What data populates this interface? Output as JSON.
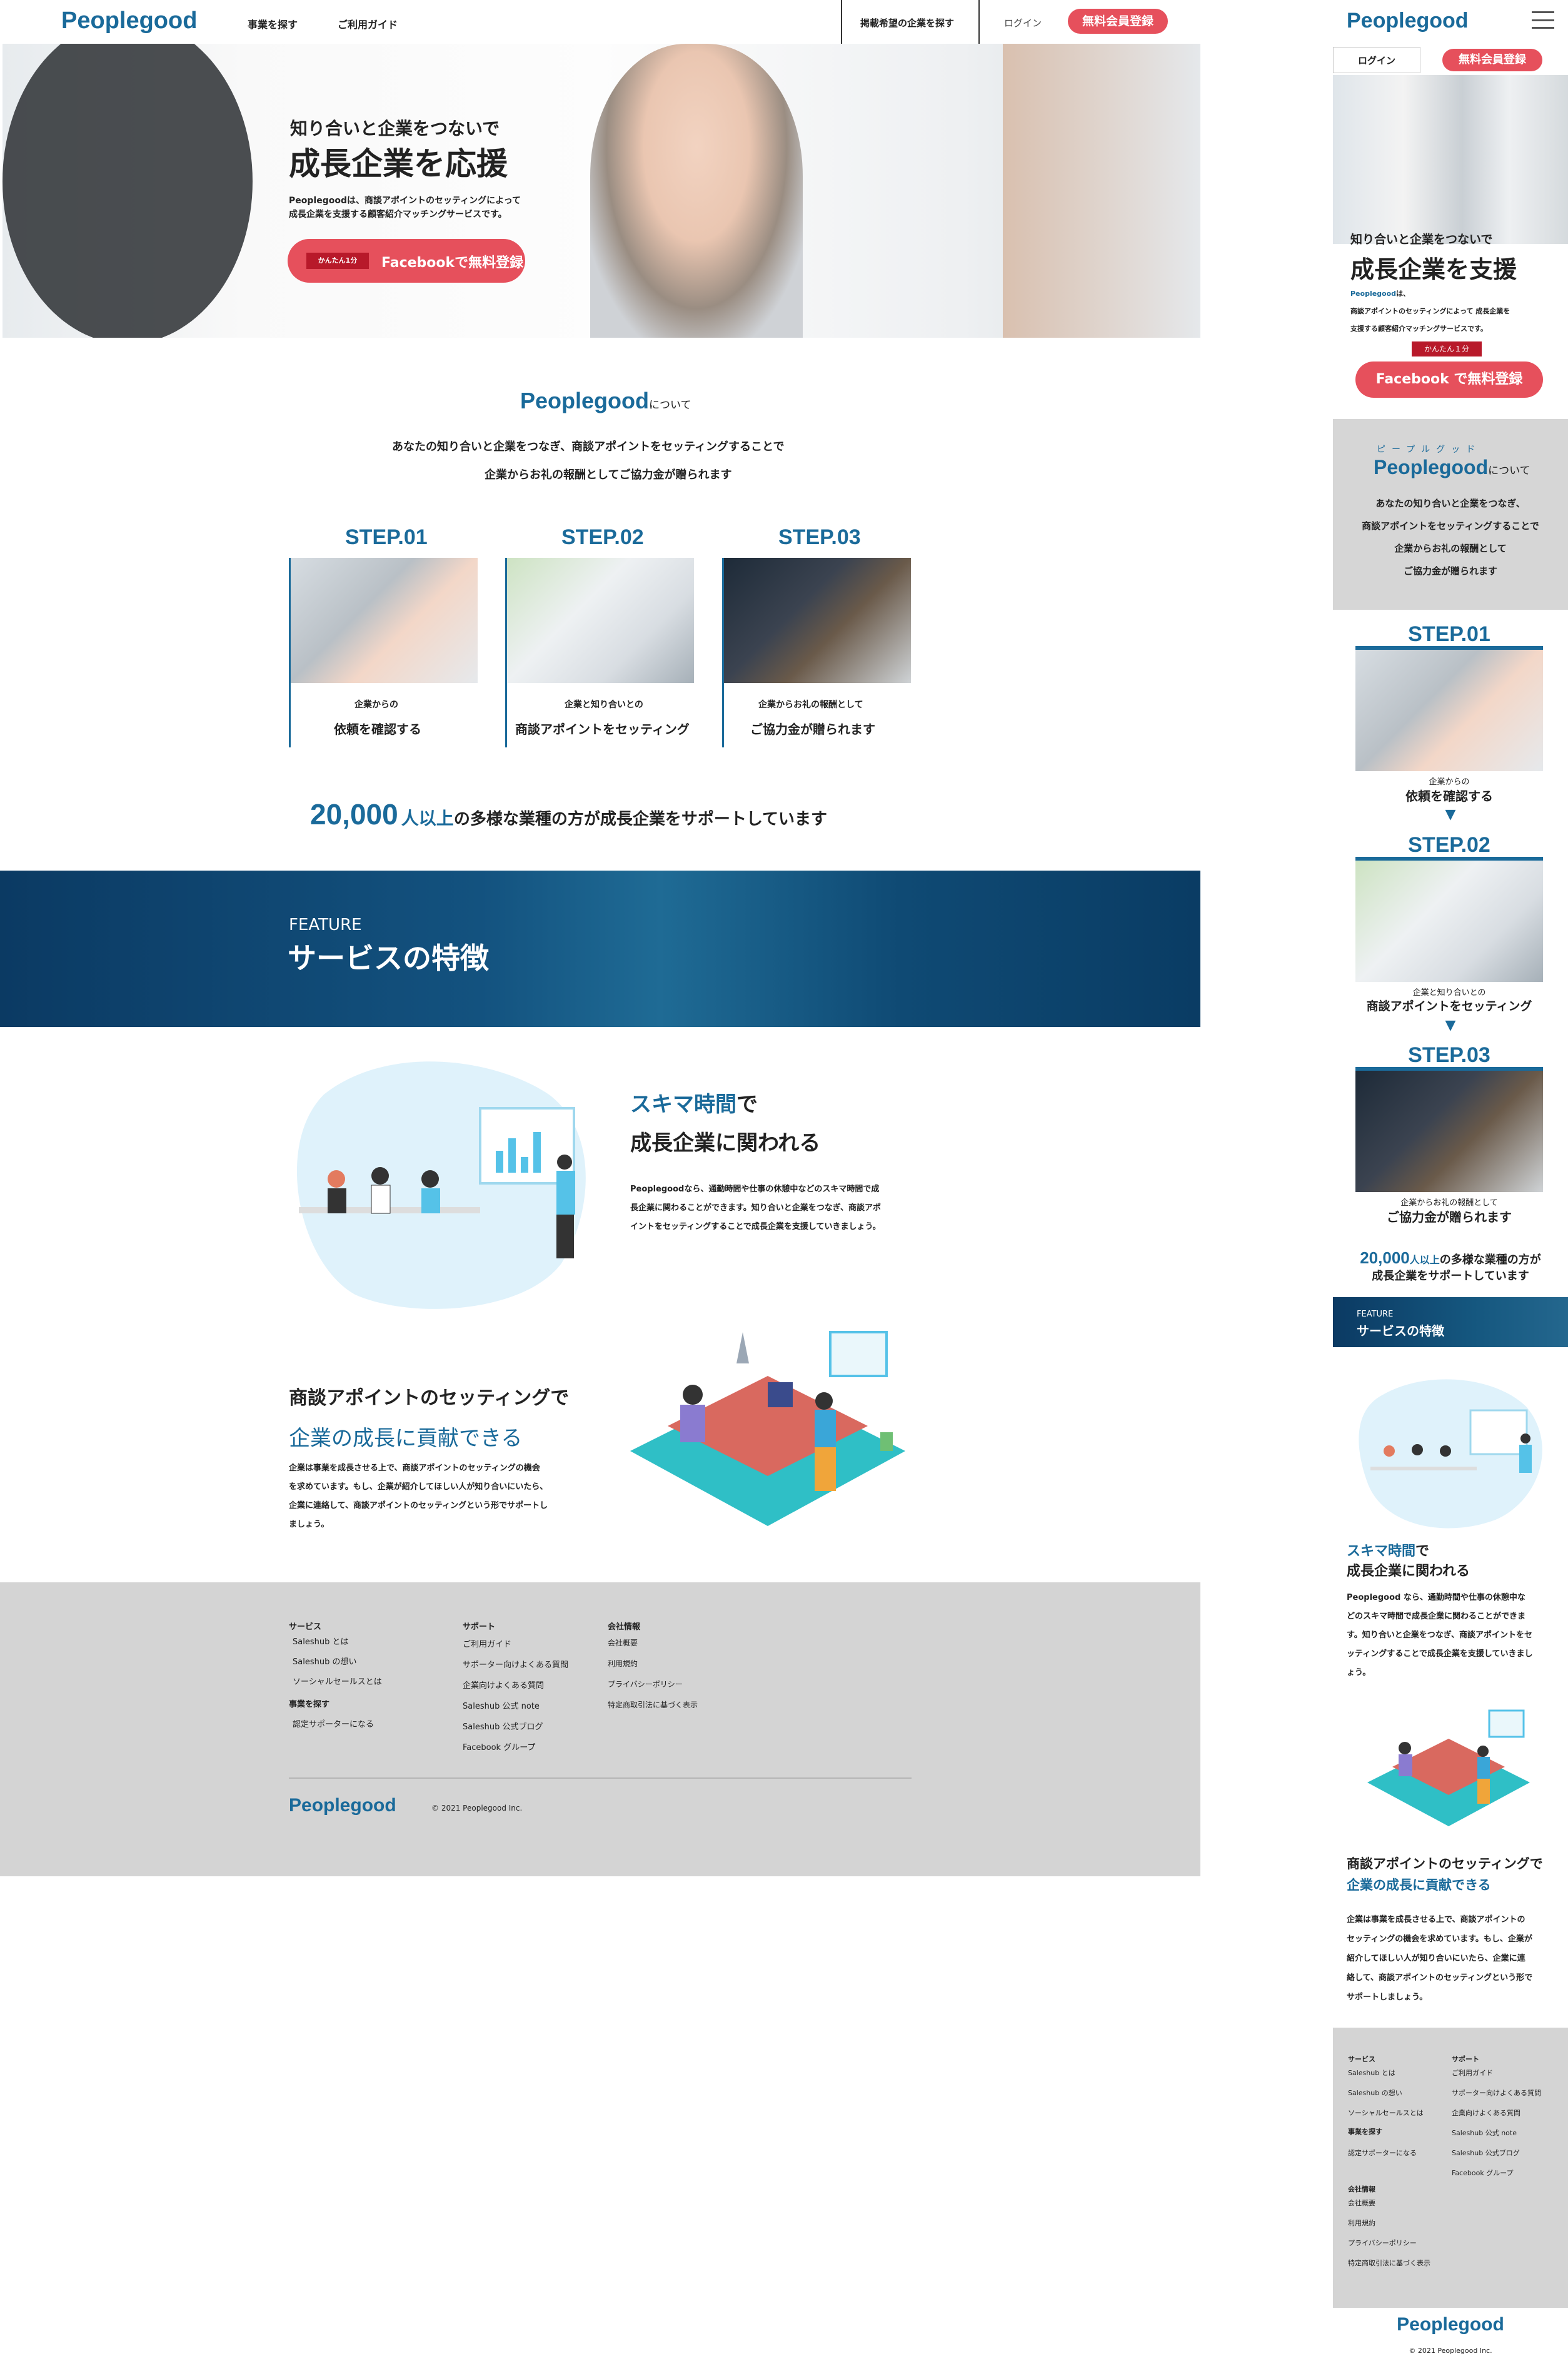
{
  "desktop": {
    "header": {
      "logo": "Peoplegood",
      "nav": [
        "事業を探す",
        "ご利用ガイド"
      ],
      "listing": "掲載希望の企業を探す",
      "login": "ログイン",
      "signup": "無料会員登録"
    },
    "hero": {
      "sub": "知り合いと企業をつないで",
      "title": "成長企業を応援",
      "desc1": "Peoplegoodは、商談アポイントのセッティングによって",
      "desc2": "成長企業を支援する顧客紹介マッチングサービスです。",
      "badge": "かんたん1分",
      "cta": "Facebookで無料登録"
    },
    "about": {
      "logo": "Peoplegood",
      "suffix": "について",
      "line1": "あなたの知り合いと企業をつなぎ、商談アポイントをセッティングすることで",
      "line2": "企業からお礼の報酬としてご協力金が贈られます"
    },
    "steps": [
      {
        "label": "STEP.01",
        "small": "企業からの",
        "big": "依頼を確認する"
      },
      {
        "label": "STEP.02",
        "small": "企業と知り合いとの",
        "big": "商談アポイントをセッティング"
      },
      {
        "label": "STEP.03",
        "small": "企業からお礼の報酬として",
        "big": "ご協力金が贈られます"
      }
    ],
    "stat": {
      "num": "20,000",
      "unit": "人以上",
      "text": "の多様な業種の方が成長企業をサポートしています"
    },
    "feature": {
      "en": "FEATURE",
      "jp": "サービスの特徴"
    },
    "f1": {
      "accent": "スキマ時間",
      "rest": "で",
      "line2": "成長企業に関われる",
      "desc1": "Peoplegoodなら、通勤時間や仕事の休憩中などのスキマ時間で成",
      "desc2": "長企業に関わることができます。知り合いと企業をつなぎ、商談アポ",
      "desc3": "イントをセッティングすることで成長企業を支援していきましょう。"
    },
    "f2": {
      "line1": "商談アポイントのセッティングで",
      "accent": "企業の成長に貢献できる",
      "desc1": "企業は事業を成長させる上で、商談アポイントのセッティングの機会",
      "desc2": "を求めています。もし、企業が紹介してほしい人が知り合いにいたら、",
      "desc3": "企業に連絡して、商談アポイントのセッティングという形でサポートし",
      "desc4": "ましょう。"
    },
    "footer": {
      "col1": {
        "h1": "サービス",
        "items": [
          "Saleshub とは",
          "Saleshub の想い",
          "ソーシャルセールスとは"
        ],
        "h2": "事業を探す",
        "items2": [
          "認定サポーターになる"
        ]
      },
      "col2": {
        "h": "サポート",
        "items": [
          "ご利用ガイド",
          "サポーター向けよくある質問",
          "企業向けよくある質問",
          "Saleshub 公式 note",
          "Saleshub 公式ブログ",
          "Facebook グループ"
        ]
      },
      "col3": {
        "h": "会社情報",
        "items": [
          "会社概要",
          "利用規約",
          "プライバシーポリシー",
          "特定商取引法に基づく表示"
        ]
      },
      "logo": "Peoplegood",
      "copy": "© 2021 Peoplegood Inc."
    }
  },
  "mobile": {
    "logo": "Peoplegood",
    "login": "ログイン",
    "signup": "無料会員登録",
    "hero": {
      "sub": "知り合いと企業をつないで",
      "title": "成長企業を支援",
      "brand": "Peoplegood",
      "desc0": "は、",
      "desc1": "商談アポイントのセッティングによって 成長企業を",
      "desc2": "支援する顧客紹介マッチングサービスです。",
      "badge": "かんたん１分",
      "cta": "Facebook で無料登録"
    },
    "about": {
      "ruby": "ピープルグッド",
      "logo": "Peoplegood",
      "suffix": "について",
      "lines": [
        "あなたの知り合いと企業をつなぎ、",
        "商談アポイントをセッティングすることで",
        "企業からお礼の報酬として",
        "ご協力金が贈られます"
      ]
    },
    "steps": [
      {
        "label": "STEP.01",
        "small": "企業からの",
        "big": "依頼を確認する"
      },
      {
        "label": "STEP.02",
        "small": "企業と知り合いとの",
        "big": "商談アポイントをセッティング"
      },
      {
        "label": "STEP.03",
        "small": "企業からお礼の報酬として",
        "big": "ご協力金が贈られます"
      }
    ],
    "arrow": "▼",
    "stat": {
      "num": "20,000",
      "unit": "人以上",
      "t1": "の多様な業種の方が",
      "t2": "成長企業をサポートしています"
    },
    "feature": {
      "en": "FEATURE",
      "jp": "サービスの特徴"
    },
    "f1": {
      "accent": "スキマ時間",
      "rest": "で",
      "line2": "成長企業に関われる",
      "lines": [
        "Peoplegood なら、通勤時間や仕事の休憩中な",
        "どのスキマ時間で成長企業に関わることができま",
        "す。知り合いと企業をつなぎ、商談アポイントをセ",
        "ッティングすることで成長企業を支援していきまし",
        "ょう。"
      ]
    },
    "f2": {
      "line1": "商談アポイントのセッティングで",
      "accent": "企業の成長に貢献できる",
      "lines": [
        "企業は事業を成長させる上で、商談アポイントの",
        "セッティングの機会を求めています。もし、企業が",
        "紹介してほしい人が知り合いにいたら、企業に連",
        "絡して、商談アポイントのセッティングという形で",
        "サポートしましょう。"
      ]
    },
    "footer": {
      "h1": "サービス",
      "i1": [
        "Saleshub とは",
        "Saleshub の想い",
        "ソーシャルセールスとは"
      ],
      "h2": "事業を探す",
      "i2": [
        "認定サポーターになる"
      ],
      "h3": "サポート",
      "i3": [
        "ご利用ガイド",
        "サポーター向けよくある質問",
        "企業向けよくある質問",
        "Saleshub 公式 note",
        "Saleshub 公式ブログ",
        "Facebook グループ"
      ],
      "h4": "会社情報",
      "i4": [
        "会社概要",
        "利用規約",
        "プライバシーポリシー",
        "特定商取引法に基づく表示"
      ],
      "logo": "Peoplegood",
      "copy": "© 2021 Peoplegood Inc."
    }
  }
}
